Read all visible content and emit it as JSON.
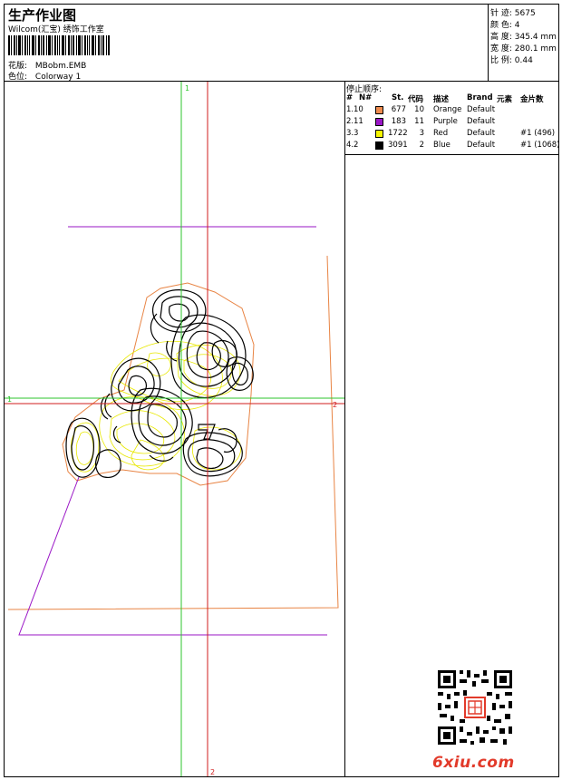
{
  "header": {
    "title": "生产作业图",
    "company": "Wilcom(汇宝) 绣饰工作室",
    "design_label": "花版:",
    "design_value": "MBobm.EMB",
    "colorway_label": "色位:",
    "colorway_value": "Colorway 1"
  },
  "stats": [
    {
      "label": "针 迹:",
      "value": "5675"
    },
    {
      "label": "颜 色:",
      "value": "4"
    },
    {
      "label": "高 度:",
      "value": "345.4 mm"
    },
    {
      "label": "宽 度:",
      "value": "280.1 mm"
    },
    {
      "label": "比 例:",
      "value": "0.44"
    }
  ],
  "stop_sequence": {
    "title": "停止顺序:",
    "headers": {
      "index": "#",
      "needle": "N#",
      "stitches": "St.",
      "code": "代码",
      "desc": "描述",
      "brand": "Brand",
      "element": "元素",
      "seq": "金片数"
    },
    "rows": [
      {
        "index": "1.",
        "needle": "10",
        "color": "#f08c4f",
        "stitches": "677",
        "code": "10",
        "desc": "Orange",
        "brand": "Default",
        "seq": ""
      },
      {
        "index": "2.",
        "needle": "11",
        "color": "#9a16c6",
        "stitches": "183",
        "code": "11",
        "desc": "Purple",
        "brand": "Default",
        "seq": ""
      },
      {
        "index": "3.",
        "needle": "3",
        "color": "#f5f500",
        "stitches": "1722",
        "code": "3",
        "desc": "Red",
        "brand": "Default",
        "seq": "#1 (496)"
      },
      {
        "index": "4.",
        "needle": "2",
        "color": "#000000",
        "stitches": "3091",
        "code": "2",
        "desc": "Blue",
        "brand": "Default",
        "seq": "#1 (1068)"
      }
    ]
  },
  "design_view": {
    "axis_labels": {
      "green_v": "1",
      "green_h": "1",
      "red_h": "2",
      "red_v": "2"
    },
    "colors": {
      "green": "#2cc62c",
      "red": "#d21c1c",
      "orange": "#e88444",
      "purple": "#9a16c6",
      "yellow": "#e8e800"
    }
  },
  "logo": {
    "text": "6xiu.com",
    "qr_icon": "qr-code-icon"
  }
}
